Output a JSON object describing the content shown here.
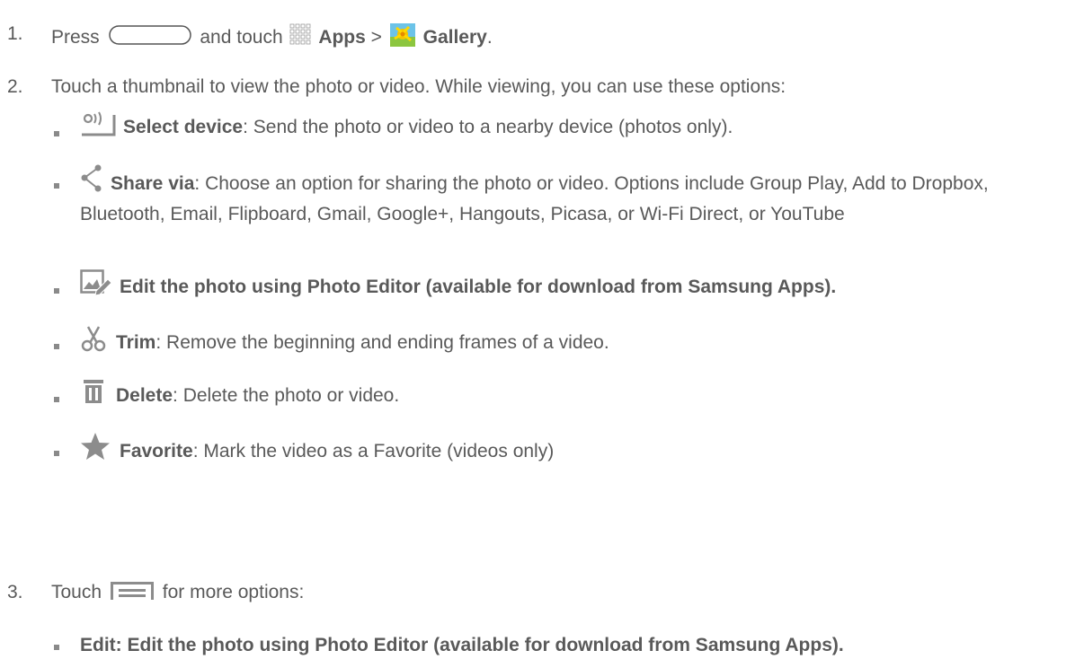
{
  "steps": [
    {
      "num": "1.",
      "pre": "Press",
      "mid": "and touch",
      "apps_label": "Apps",
      "sep": ">",
      "gallery_label": "Gallery",
      "end": "."
    },
    {
      "num": "2.",
      "text": "Touch a thumbnail to view the photo or video. While viewing, you can use these options:"
    },
    {
      "num": "3.",
      "pre": "Touch",
      "post": "for more options:"
    }
  ],
  "options": [
    {
      "icon": "select-device-icon",
      "label": "Select device",
      "desc": ": Send the photo or video to a nearby device (photos only)."
    },
    {
      "icon": "share-icon",
      "label": "Share via",
      "desc": ": Choose an option for sharing the photo or video. Options include Group Play, Add to Dropbox, Bluetooth, Email, Flipboard, Gmail, Google+, Hangouts, Picasa, or Wi-Fi Direct, or YouTube"
    },
    {
      "icon": "edit-photo-icon",
      "label": "Edit the photo using Photo Editor (available for download from Samsung Apps).",
      "desc": ""
    },
    {
      "icon": "scissors-icon",
      "label": "Trim",
      "desc": ": Remove the beginning and ending frames of a video."
    },
    {
      "icon": "trash-icon",
      "label": "Delete",
      "desc": ": Delete the photo or video."
    },
    {
      "icon": "star-icon",
      "label": "Favorite",
      "desc": ": Mark the video as a Favorite (videos only)"
    }
  ],
  "more_options": [
    {
      "label": "Edit: Edit the photo using Photo Editor (available for download from Samsung Apps)."
    }
  ],
  "colors": {
    "text": "#595959",
    "icon_gray": "#8c8c8c",
    "bullet": "#8a8a8a"
  }
}
